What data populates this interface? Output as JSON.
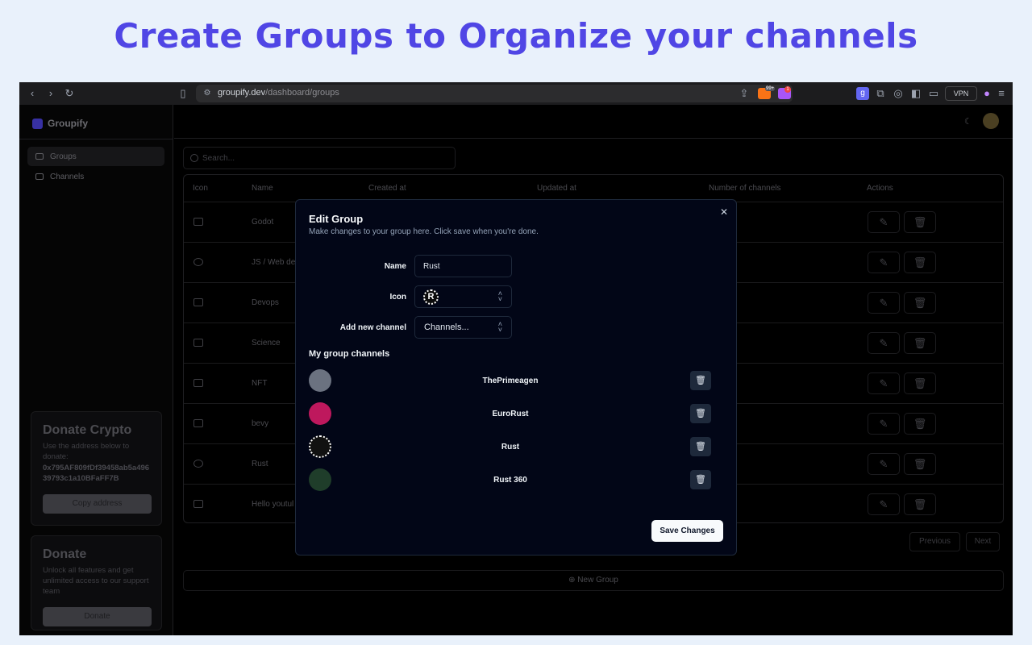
{
  "hero": {
    "title": "Create Groups to Organize your channels"
  },
  "browser": {
    "url_domain": "groupify.dev",
    "url_path": "/dashboard/groups",
    "brave_badge": "99+",
    "alert_badge": "1",
    "vpn_label": "VPN"
  },
  "sidebar": {
    "app_name": "Groupify",
    "items": [
      {
        "label": "Groups",
        "icon": "video-icon"
      },
      {
        "label": "Channels",
        "icon": "channels-icon"
      }
    ],
    "donate_crypto": {
      "title": "Donate Crypto",
      "body": "Use the address below to donate:",
      "address": "0x795AF809fDf39458ab5a49639793c1a10BFaFF7B",
      "button": "Copy address"
    },
    "donate": {
      "title": "Donate",
      "body": "Unlock all features and get unlimited access to our support team",
      "button": "Donate"
    }
  },
  "search": {
    "placeholder": "Search..."
  },
  "table": {
    "columns": [
      "Icon",
      "Name",
      "Created at",
      "Updated at",
      "Number of channels",
      "Actions"
    ],
    "rows": [
      {
        "icon": "gamepad-icon",
        "name": "Godot"
      },
      {
        "icon": "virus-icon",
        "name": "JS / Web de"
      },
      {
        "icon": "box-icon",
        "name": "Devops"
      },
      {
        "icon": "flask-icon",
        "name": "Science"
      },
      {
        "icon": "bitcoin-icon",
        "name": "NFT"
      },
      {
        "icon": "bird-icon",
        "name": "bevy"
      },
      {
        "icon": "rust-icon",
        "name": "Rust"
      },
      {
        "icon": "youtube-icon",
        "name": "Hello youtul"
      }
    ]
  },
  "pager": {
    "previous": "Previous",
    "next": "Next"
  },
  "new_group": {
    "label": "New Group"
  },
  "modal": {
    "title": "Edit Group",
    "description": "Make changes to your group here. Click save when you're done.",
    "name_label": "Name",
    "name_value": "Rust",
    "icon_label": "Icon",
    "add_channel_label": "Add new channel",
    "add_channel_value": "Channels...",
    "section_title": "My group channels",
    "channels": [
      {
        "name": "ThePrimeagen",
        "avatar_color": "#6b7280"
      },
      {
        "name": "EuroRust",
        "avatar_color": "#be185d"
      },
      {
        "name": "Rust",
        "avatar_color": "#111111"
      },
      {
        "name": "Rust 360",
        "avatar_color": "#1f3d2a"
      }
    ],
    "save_label": "Save Changes"
  }
}
